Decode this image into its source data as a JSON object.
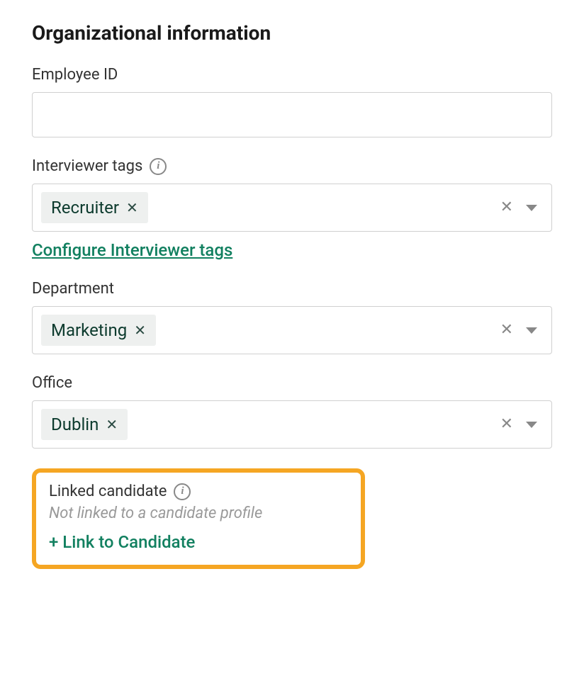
{
  "section": {
    "title": "Organizational information"
  },
  "fields": {
    "employee_id": {
      "label": "Employee ID",
      "value": ""
    },
    "interviewer_tags": {
      "label": "Interviewer tags",
      "tags": [
        "Recruiter"
      ],
      "config_link": "Configure Interviewer tags"
    },
    "department": {
      "label": "Department",
      "tags": [
        "Marketing"
      ]
    },
    "office": {
      "label": "Office",
      "tags": [
        "Dublin"
      ]
    },
    "linked_candidate": {
      "label": "Linked candidate",
      "status": "Not linked to a candidate profile",
      "action": "+ Link to Candidate"
    }
  },
  "glyphs": {
    "info": "i",
    "tag_remove": "✕",
    "clear_all": "✕"
  }
}
